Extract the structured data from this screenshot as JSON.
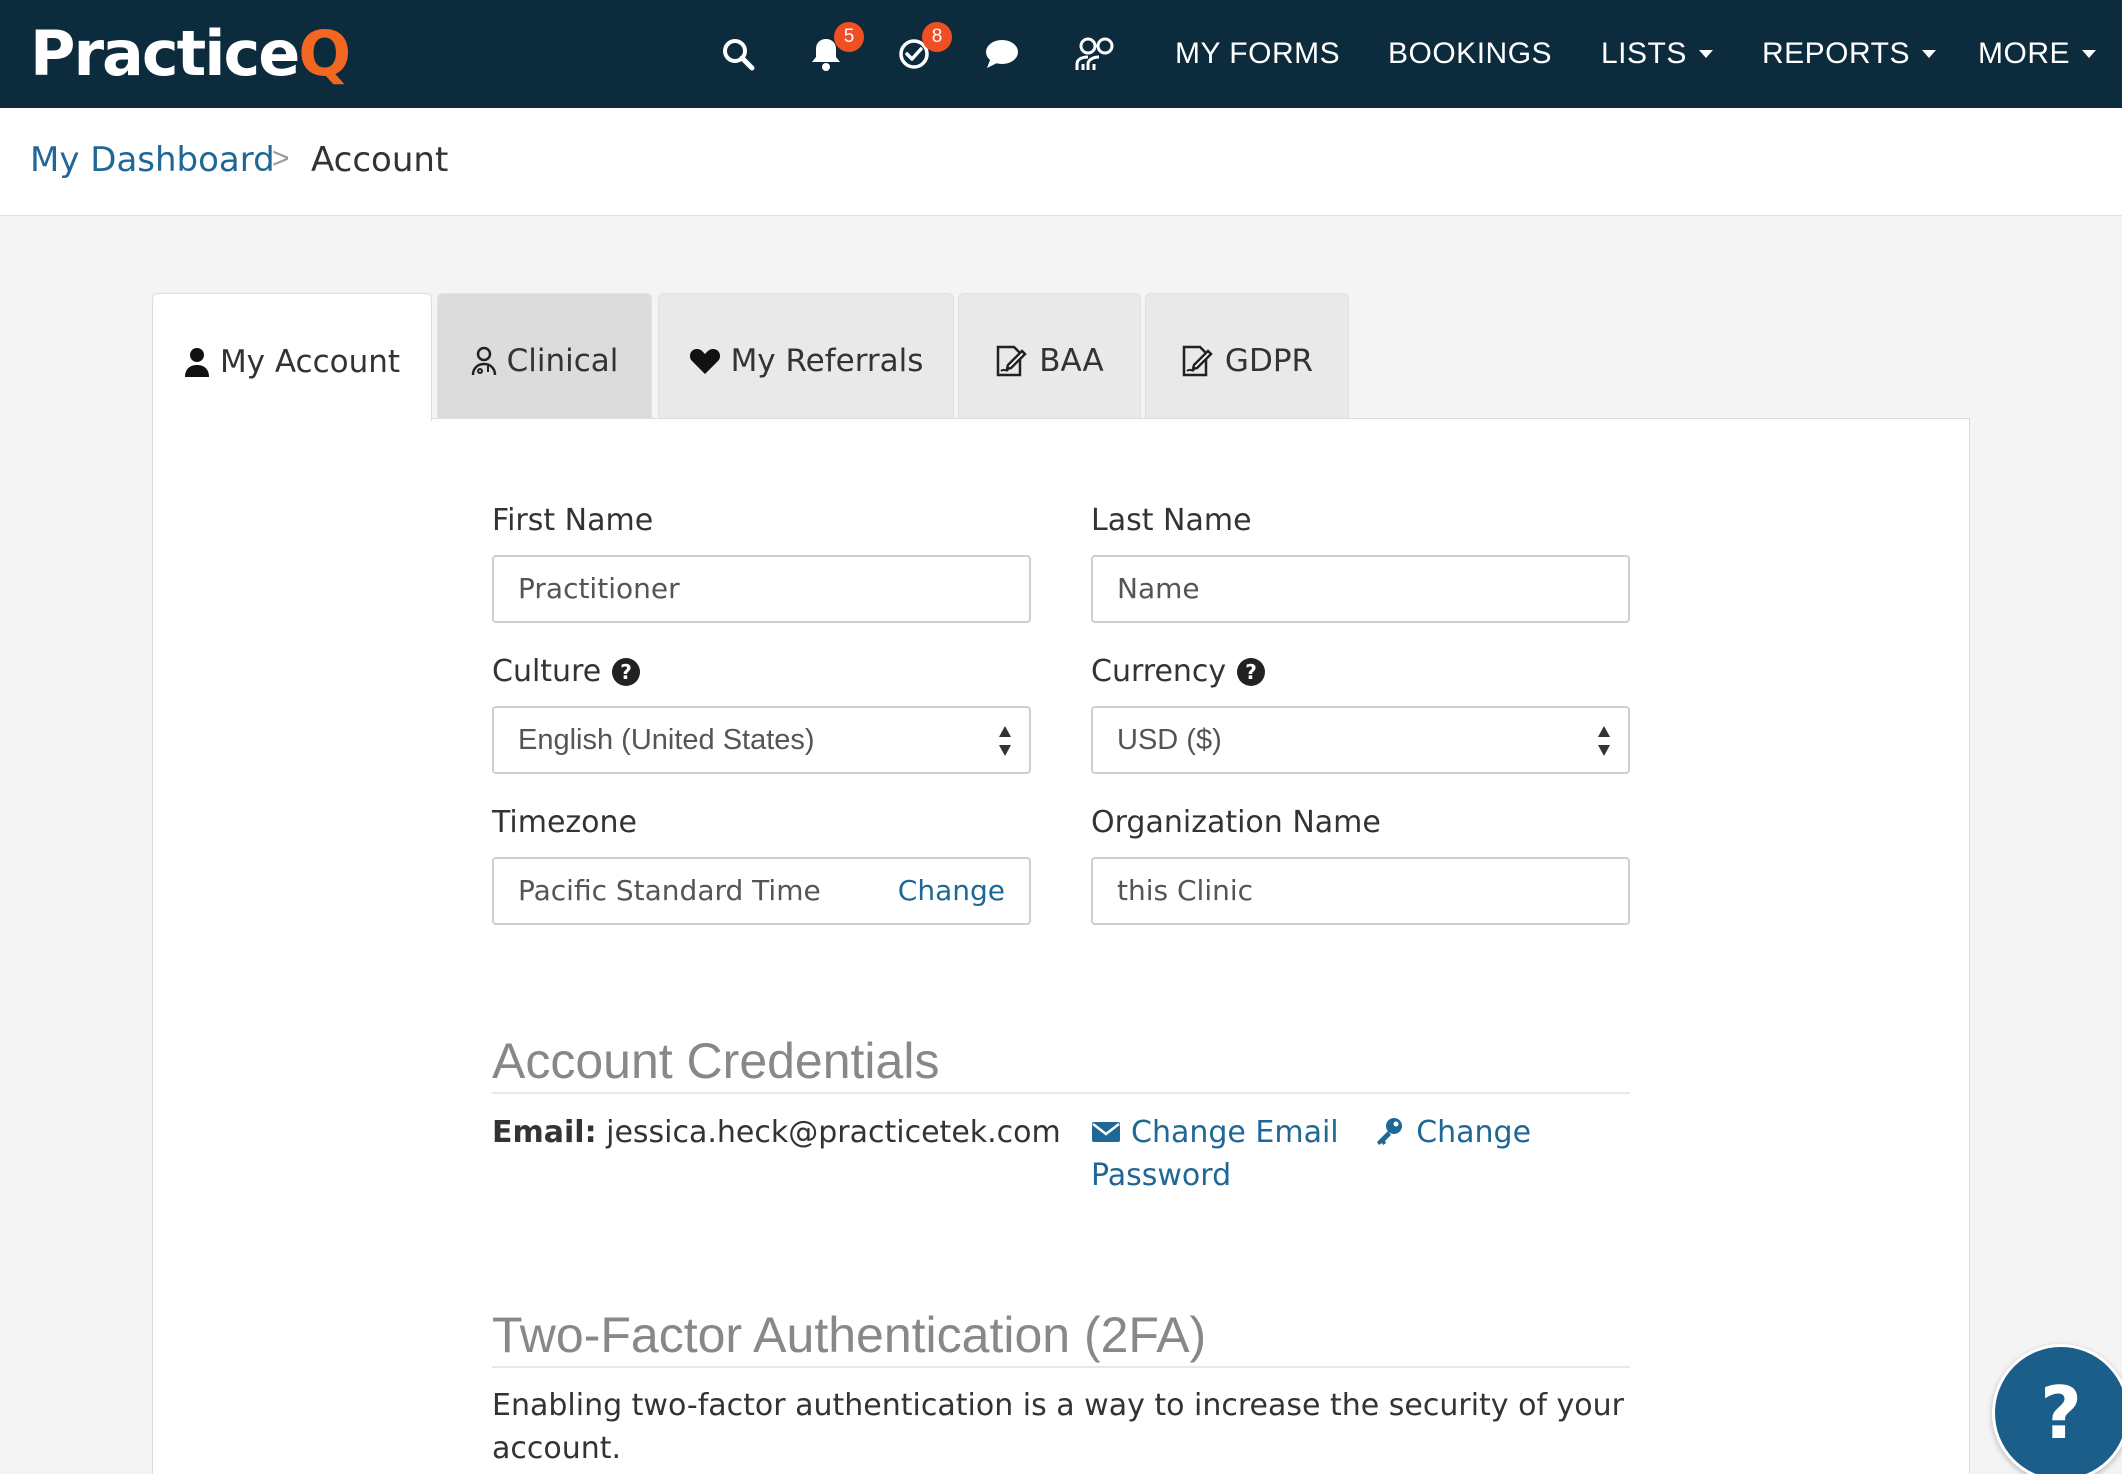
{
  "nav": {
    "logo_main": "Practice",
    "logo_accent": "Q",
    "notifications_count": "5",
    "tasks_count": "8",
    "links": {
      "my_forms": "MY FORMS",
      "bookings": "BOOKINGS",
      "lists": "LISTS",
      "reports": "REPORTS",
      "more": "MORE"
    }
  },
  "breadcrumb": {
    "home": "My Dashboard",
    "separator": ">",
    "current": "Account"
  },
  "tabs": {
    "my_account": "My Account",
    "clinical": "Clinical",
    "my_referrals": "My Referrals",
    "baa": "BAA",
    "gdpr": "GDPR"
  },
  "form": {
    "first_name_label": "First Name",
    "first_name_value": "Practitioner",
    "last_name_label": "Last Name",
    "last_name_value": "Name",
    "culture_label": "Culture",
    "culture_value": "English (United States)",
    "currency_label": "Currency",
    "currency_value": "USD ($)",
    "timezone_label": "Timezone",
    "timezone_value": "Pacific Standard Time",
    "timezone_change": "Change",
    "org_label": "Organization Name",
    "org_value": "this Clinic"
  },
  "credentials": {
    "title": "Account Credentials",
    "email_label": "Email:",
    "email_value": "jessica.heck@practicetek.com",
    "change_email": "Change Email",
    "change_password_1": "Change",
    "change_password_2": "Password"
  },
  "twofa": {
    "title": "Two-Factor Authentication (2FA)",
    "desc_line1": "Enabling two-factor authentication is a way to increase the security of your",
    "desc_line2": "account."
  },
  "colors": {
    "nav_bg": "#0c2b3d",
    "brand_accent": "#f26722",
    "badge": "#f04e23",
    "link": "#1f6797",
    "help_button": "#1b5e8a"
  }
}
